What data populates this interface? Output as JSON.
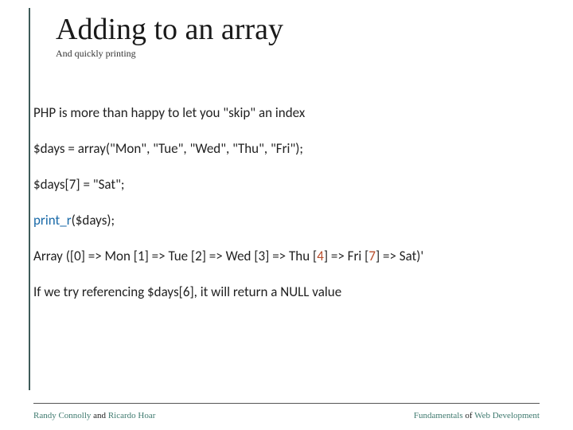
{
  "title": "Adding to an array",
  "subtitle": "And quickly printing",
  "lines": {
    "intro": "PHP is more than happy to let you \"skip\" an index",
    "code1": "$days = array(\"Mon\", \"Tue\", \"Wed\", \"Thu\", \"Fri\");",
    "code2": "$days[7] = \"Sat\";",
    "fn": "print_r",
    "code3_rest": "($days);",
    "out_a": "Array ([0] => Mon [1] => Tue [2] => Wed [3] => Thu [",
    "out_i4": "4",
    "out_b": "] => Fri [",
    "out_i7": "7",
    "out_c": "] => Sat)'",
    "ref_a": "If we try referencing $days[6], it will return a ",
    "ref_null": "NULL",
    "ref_b": " value"
  },
  "footer": {
    "left_a": "Randy Connolly ",
    "left_mid": "and",
    "left_b": " Ricardo Hoar",
    "right_a": "Fundamentals ",
    "right_mid": "of",
    "right_b": " Web Development"
  }
}
